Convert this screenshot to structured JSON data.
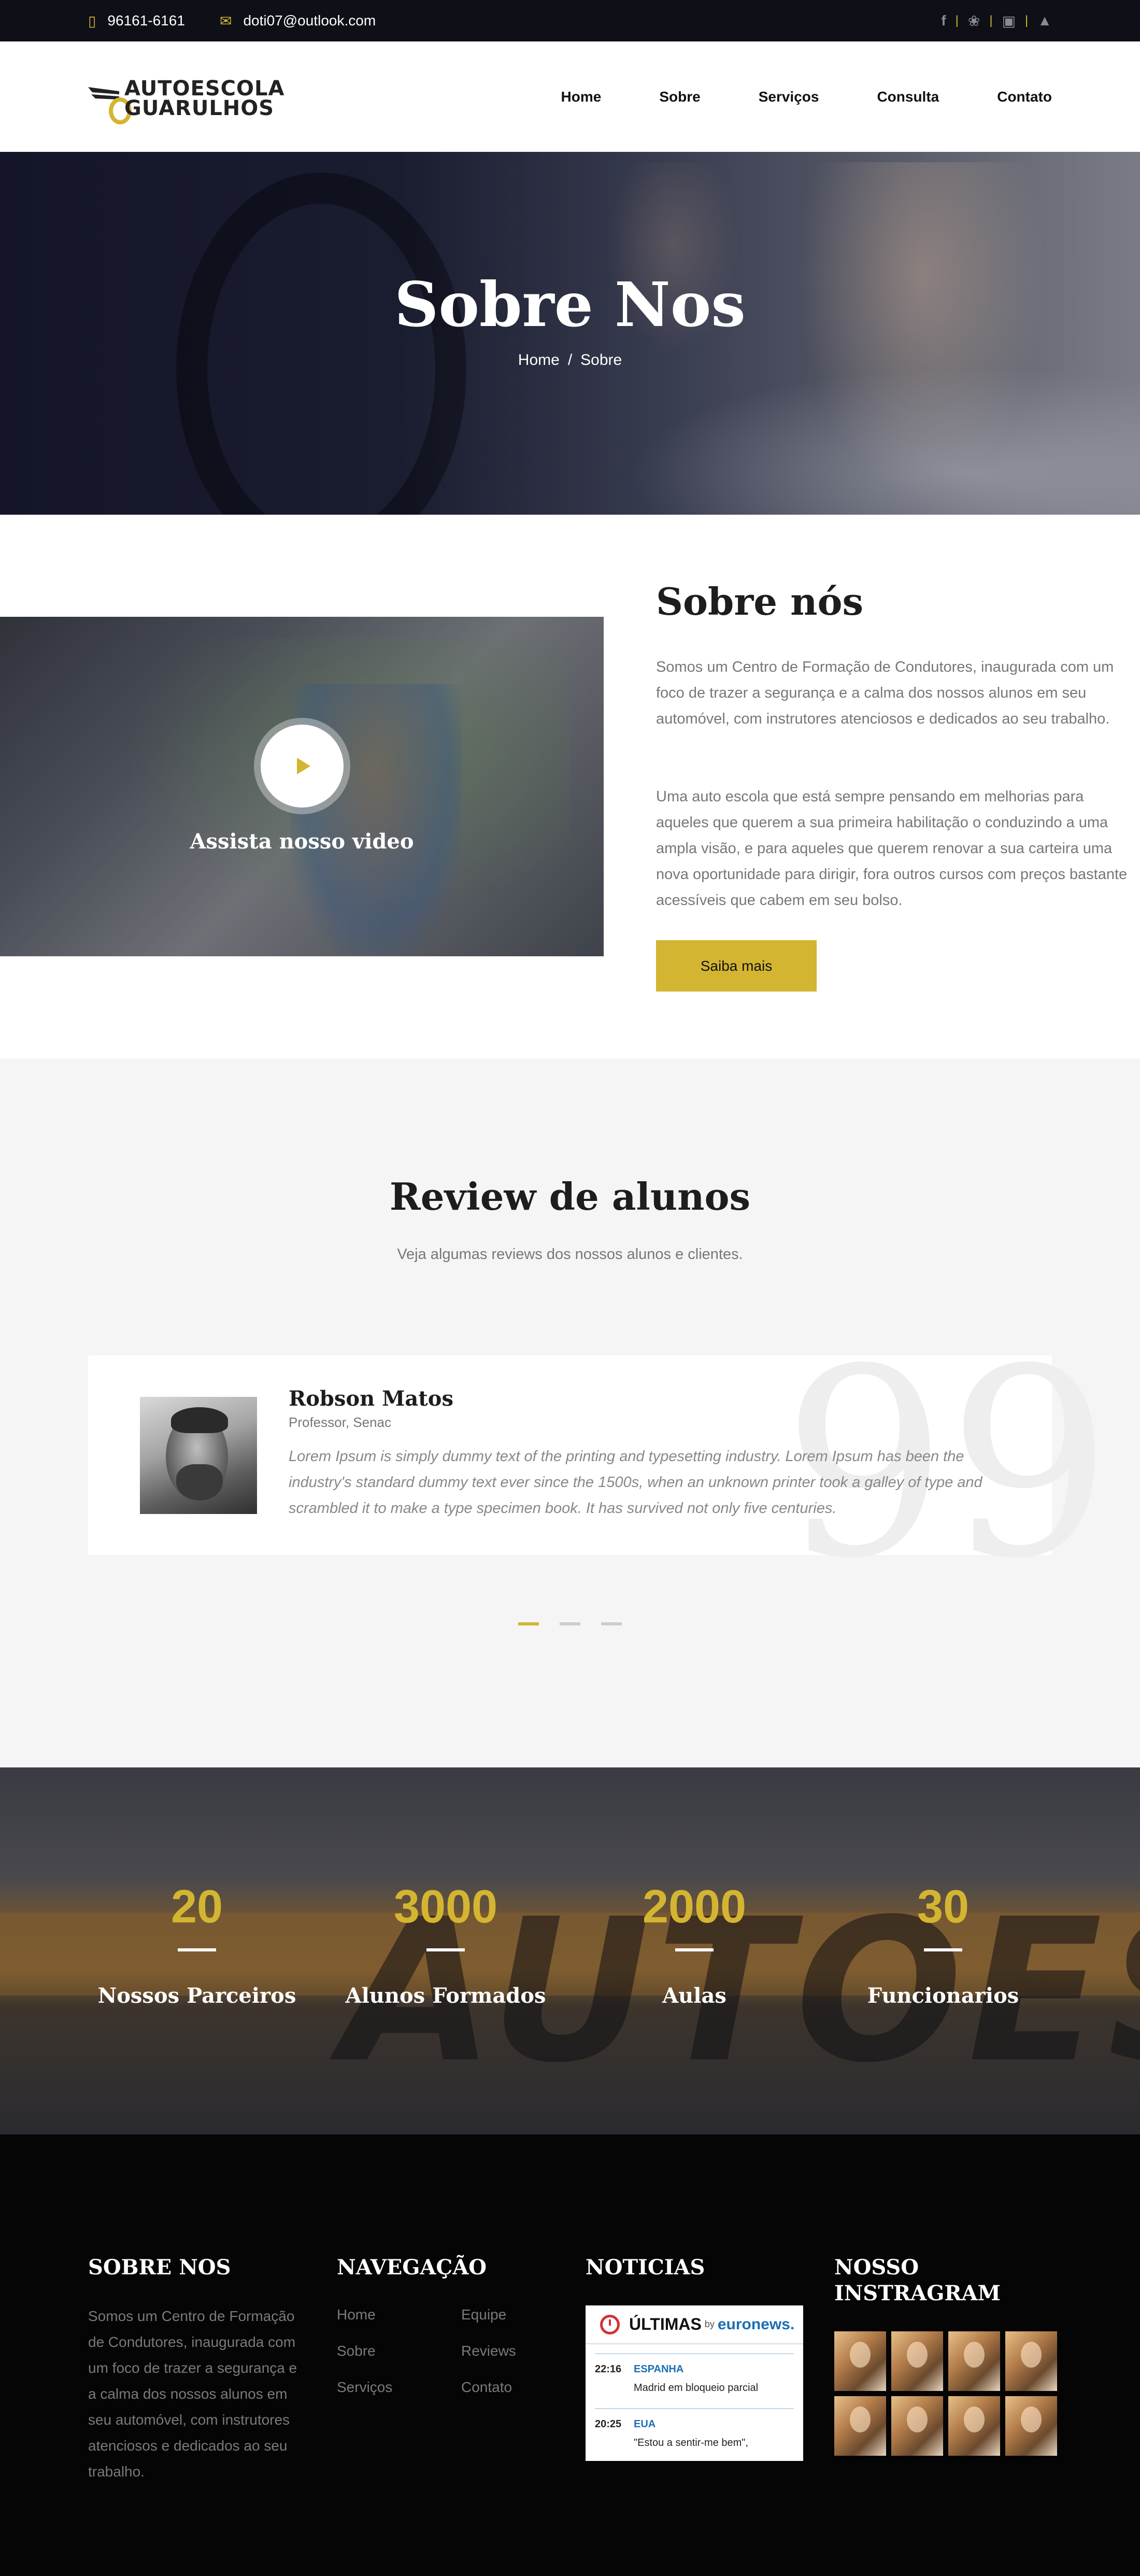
{
  "topbar": {
    "phone": "96161-6161",
    "email": "doti07@outlook.com",
    "socials": [
      "facebook-icon",
      "twitter-icon",
      "instagram-icon",
      "android-icon"
    ]
  },
  "logo": {
    "line1": "AUTOESCOLA",
    "line2": "GUARULHOS"
  },
  "nav": [
    "Home",
    "Sobre",
    "Serviços",
    "Consulta",
    "Contato"
  ],
  "hero": {
    "title": "Sobre Nos",
    "breadcrumb": {
      "home": "Home",
      "separator": "/",
      "current": "Sobre"
    }
  },
  "about": {
    "video_label": "Assista nosso video",
    "title": "Sobre nós",
    "p1": "Somos um Centro de Formação de Condutores, inaugurada com um foco de trazer a segurança e a calma dos nossos alunos em seu automóvel, com instrutores atenciosos e dedicados ao seu trabalho.",
    "p2": "Uma auto escola que está sempre pensando em melhorias para aqueles que querem a sua primeira habilitação o conduzindo a uma ampla visão, e para aqueles que querem renovar a sua carteira uma nova oportunidade para dirigir, fora outros cursos com preços bastante acessíveis que cabem em seu bolso.",
    "button": "Saiba mais"
  },
  "reviews": {
    "title": "Review de alunos",
    "subtitle": "Veja algumas reviews dos nossos alunos e clientes.",
    "items": [
      {
        "name": "Robson Matos",
        "role": "Professor, Senac",
        "text": "Lorem Ipsum is simply dummy text of the printing and typesetting industry. Lorem Ipsum has been the industry's standard dummy text ever since the 1500s, when an unknown printer took a galley of type and scrambled it to make a type specimen book. It has survived not only five centuries."
      }
    ],
    "quote_mark": "99",
    "active_dot": 0,
    "dot_count": 3
  },
  "counters": {
    "background_text": "AUTOESC",
    "items": [
      {
        "value": "20",
        "label": "Nossos Parceiros"
      },
      {
        "value": "3000",
        "label": "Alunos Formados"
      },
      {
        "value": "2000",
        "label": "Aulas"
      },
      {
        "value": "30",
        "label": "Funcionarios"
      }
    ]
  },
  "footer": {
    "about_title": "SOBRE NOS",
    "about_text": "Somos um Centro de Formação de Condutores, inaugurada com um foco de trazer a segurança e a calma dos nossos alunos em seu automóvel, com instrutores atenciosos e dedicados ao seu trabalho.",
    "nav_title": "NAVEGAÇÃO",
    "nav_col1": [
      "Home",
      "Sobre",
      "Serviços"
    ],
    "nav_col2": [
      "Equipe",
      "Reviews",
      "Contato"
    ],
    "news_title": "NOTICIAS",
    "news_widget": {
      "head": "ÚLTIMAS",
      "by": "by",
      "brand": "euronews.",
      "items": [
        {
          "time": "22:16",
          "category": "ESPANHA",
          "text": "Madrid em bloqueio parcial"
        },
        {
          "time": "20:25",
          "category": "EUA",
          "text": "\"Estou a sentir-me bem\","
        }
      ]
    },
    "insta_title": "NOSSO INSTRAGRAM",
    "insta_count": 8
  },
  "colors": {
    "accent": "#d4b531",
    "dark": "#0f1017",
    "footer_bg": "#050505"
  }
}
